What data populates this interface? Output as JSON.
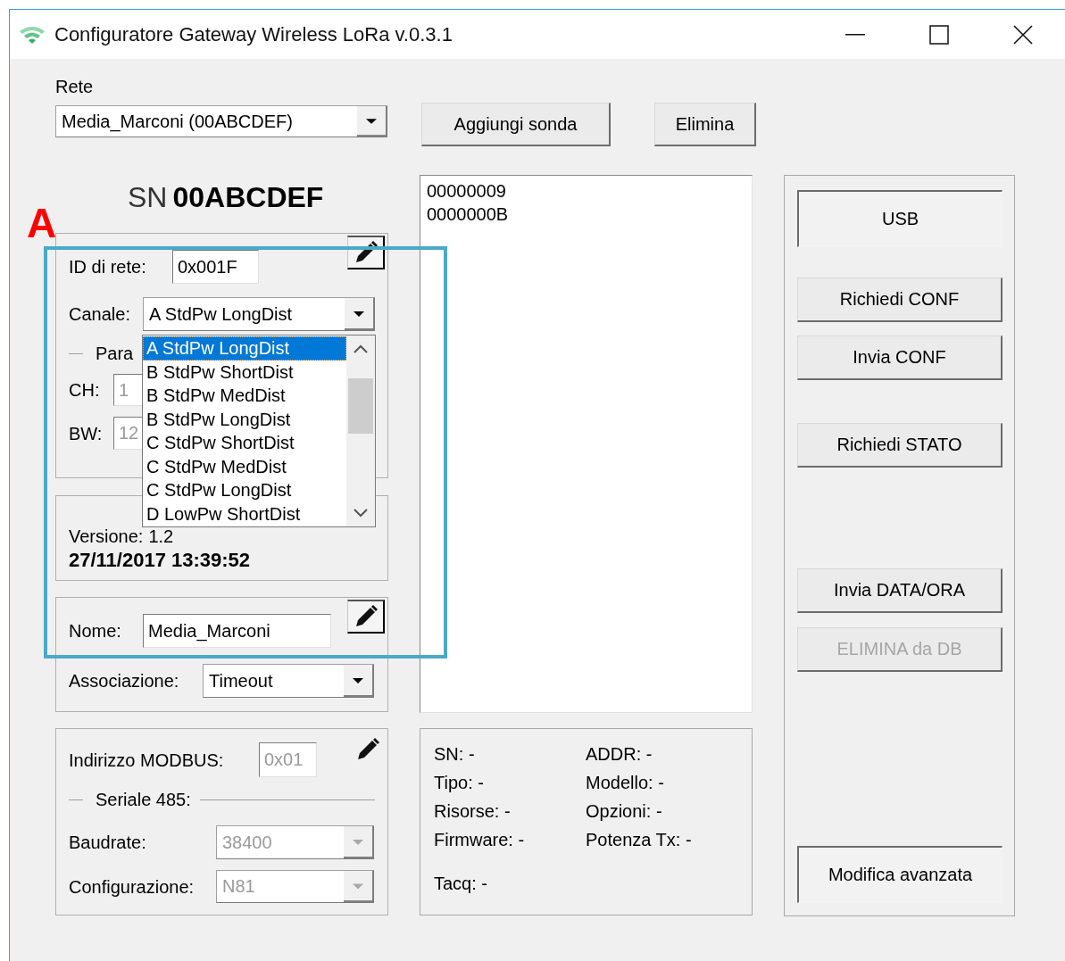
{
  "window": {
    "title": "Configuratore Gateway Wireless LoRa v.0.3.1"
  },
  "annotation": {
    "label": "A"
  },
  "rete": {
    "label": "Rete",
    "value": "Media_Marconi (00ABCDEF)"
  },
  "top_buttons": [
    {
      "label": "Aggiungi sonda"
    },
    {
      "label": "Elimina"
    }
  ],
  "serial_number": {
    "prefix": "SN",
    "value": "00ABCDEF"
  },
  "network_group": {
    "id_label": "ID di rete:",
    "id_field": {
      "value": "0x001F",
      "disabled": false
    },
    "channel_label": "Canale:",
    "channel_value": "A StdPw LongDist",
    "params_label": "Para",
    "ch_label": "CH:",
    "ch_field": {
      "value": "1",
      "disabled": true
    },
    "bw_label": "BW:",
    "bw_field": {
      "value": "12",
      "disabled": true
    },
    "channel_options": [
      {
        "label": "A StdPw LongDist",
        "selected": true
      },
      {
        "label": "B StdPw ShortDist",
        "selected": false
      },
      {
        "label": "B StdPw MedDist",
        "selected": false
      },
      {
        "label": "B StdPw LongDist",
        "selected": false
      },
      {
        "label": "C StdPw ShortDist",
        "selected": false
      },
      {
        "label": "C StdPw MedDist",
        "selected": false
      },
      {
        "label": "C StdPw LongDist",
        "selected": false
      },
      {
        "label": "D LowPw ShortDist",
        "selected": false
      }
    ]
  },
  "version_group": {
    "version_label": "Versione:",
    "version_value": "1.2",
    "timestamp": "27/11/2017 13:39:52"
  },
  "name_group": {
    "name_label": "Nome:",
    "name_field": {
      "value": "Media_Marconi",
      "disabled": false
    },
    "association_label": "Associazione:",
    "association": {
      "value": "Timeout",
      "disabled": false
    }
  },
  "modbus_group": {
    "address_label": "Indirizzo MODBUS:",
    "address_field": {
      "value": "0x01",
      "disabled": true
    },
    "serial_label": "Seriale 485:",
    "baudrate_label": "Baudrate:",
    "baudrate": {
      "value": "38400",
      "disabled": true
    },
    "config_label": "Configurazione:",
    "config": {
      "value": "N81",
      "disabled": true
    }
  },
  "probes": [
    "00000009",
    "0000000B"
  ],
  "info_fields": [
    "SN: -",
    "ADDR: -",
    "Tipo: -",
    "Modello: -",
    "Risorse: -",
    "Opzioni: -",
    "Firmware: -",
    "Potenza Tx: -"
  ],
  "tacq": "Tacq: -",
  "side_button_groups": [
    [
      {
        "label": "USB",
        "pressed": true,
        "disabled": false
      }
    ],
    [
      {
        "label": "Richiedi CONF",
        "pressed": false,
        "disabled": false
      },
      {
        "label": "Invia CONF",
        "pressed": false,
        "disabled": false
      }
    ],
    [
      {
        "label": "Richiedi STATO",
        "pressed": false,
        "disabled": false
      }
    ],
    [
      {
        "label": "Invia DATA/ORA",
        "pressed": false,
        "disabled": false
      },
      {
        "label": "ELIMINA da DB",
        "pressed": false,
        "disabled": true
      }
    ],
    [
      {
        "label": "Modifica avanzata",
        "pressed": true,
        "disabled": false
      }
    ]
  ]
}
